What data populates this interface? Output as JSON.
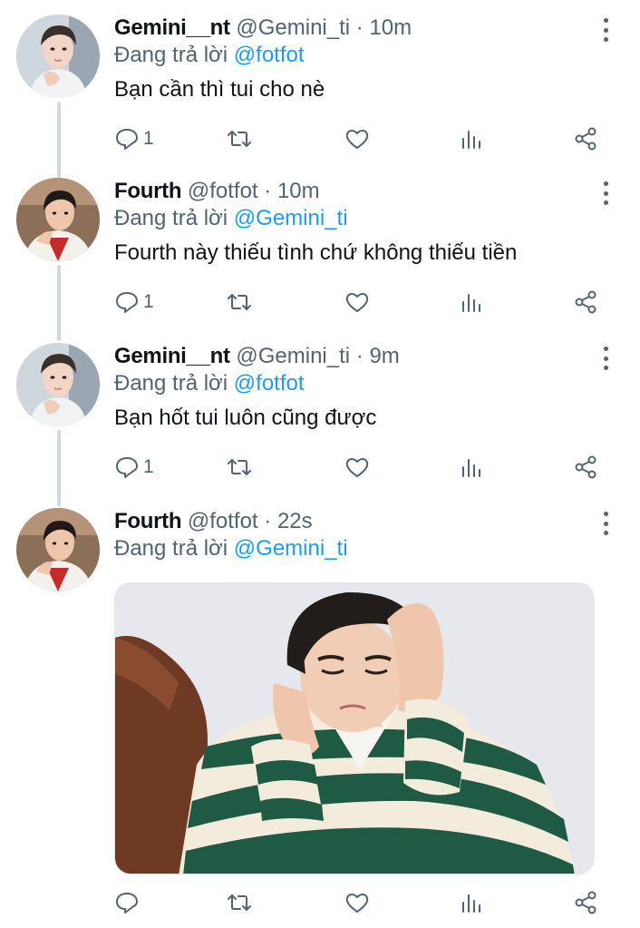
{
  "tweets": [
    {
      "name": "Gemini__nt",
      "handle": "@Gemini_ti",
      "dot": "·",
      "time": "10m",
      "replying_prefix": "Đang trả lời",
      "replying_to": "@fotfot",
      "text": "Bạn cần thì tui cho nè",
      "reply_count": "1",
      "avatar_icon": "profile-photo-gemini"
    },
    {
      "name": "Fourth",
      "handle": "@fotfot",
      "dot": "·",
      "time": "10m",
      "replying_prefix": "Đang trả lời",
      "replying_to": "@Gemini_ti",
      "text": "Fourth này thiếu tình chứ không thiếu tiền",
      "reply_count": "1",
      "avatar_icon": "profile-photo-fourth"
    },
    {
      "name": "Gemini__nt",
      "handle": "@Gemini_ti",
      "dot": "·",
      "time": "9m",
      "replying_prefix": "Đang trả lời",
      "replying_to": "@fotfot",
      "text": "Bạn hốt tui luôn cũng được",
      "reply_count": "1",
      "avatar_icon": "profile-photo-gemini"
    },
    {
      "name": "Fourth",
      "handle": "@fotfot",
      "dot": "·",
      "time": "22s",
      "replying_prefix": "Đang trả lời",
      "replying_to": "@Gemini_ti",
      "text": "",
      "reply_count": "",
      "avatar_icon": "profile-photo-fourth",
      "media": "photo of a young man in a green and white striped knit sweater covering his ears with a pained expression"
    }
  ],
  "icons": [
    "reply-icon",
    "retweet-icon",
    "like-icon",
    "stats-icon",
    "share-icon",
    "more-options-icon"
  ],
  "colors": {
    "text": "#0f1419",
    "secondary": "#536471",
    "mention": "#1d9bf0",
    "thread_line": "#cfd9de"
  }
}
